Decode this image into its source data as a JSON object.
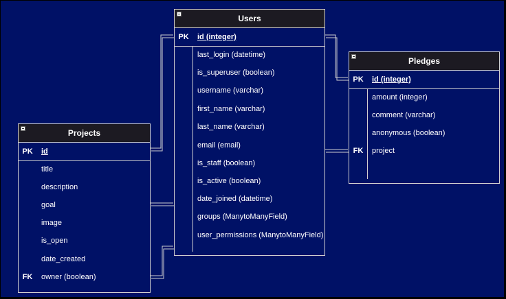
{
  "colors": {
    "background": "#001166",
    "header": "#1c1a22",
    "border": "#d0d0d0",
    "text": "#ffffff"
  },
  "entities": {
    "users": {
      "title": "Users",
      "pk": {
        "key": "PK",
        "name": "id (integer)"
      },
      "fields": [
        {
          "key": "",
          "name": "last_login (datetime)"
        },
        {
          "key": "",
          "name": "is_superuser (boolean)"
        },
        {
          "key": "",
          "name": "username (varchar)"
        },
        {
          "key": "",
          "name": "first_name (varchar)"
        },
        {
          "key": "",
          "name": "last_name (varchar)"
        },
        {
          "key": "",
          "name": "email (email)"
        },
        {
          "key": "",
          "name": "is_staff (boolean)"
        },
        {
          "key": "",
          "name": "is_active (boolean)"
        },
        {
          "key": "",
          "name": "date_joined (datetime)"
        },
        {
          "key": "",
          "name": "groups (ManytoManyField)"
        },
        {
          "key": "",
          "name": "user_permissions (ManytoManyField)"
        }
      ]
    },
    "pledges": {
      "title": "Pledges",
      "pk": {
        "key": "PK",
        "name": "id (integer)"
      },
      "fields": [
        {
          "key": "",
          "name": "amount (integer)"
        },
        {
          "key": "",
          "name": "comment (varchar)"
        },
        {
          "key": "",
          "name": "anonymous (boolean)"
        },
        {
          "key": "FK",
          "name": "project"
        }
      ]
    },
    "projects": {
      "title": "Projects",
      "pk": {
        "key": "PK",
        "name": "id"
      },
      "fields": [
        {
          "key": "",
          "name": "title"
        },
        {
          "key": "",
          "name": "description"
        },
        {
          "key": "",
          "name": "goal"
        },
        {
          "key": "",
          "name": "image"
        },
        {
          "key": "",
          "name": "is_open"
        },
        {
          "key": "",
          "name": "date_created"
        },
        {
          "key": "FK",
          "name": "owner (boolean)"
        }
      ]
    }
  }
}
